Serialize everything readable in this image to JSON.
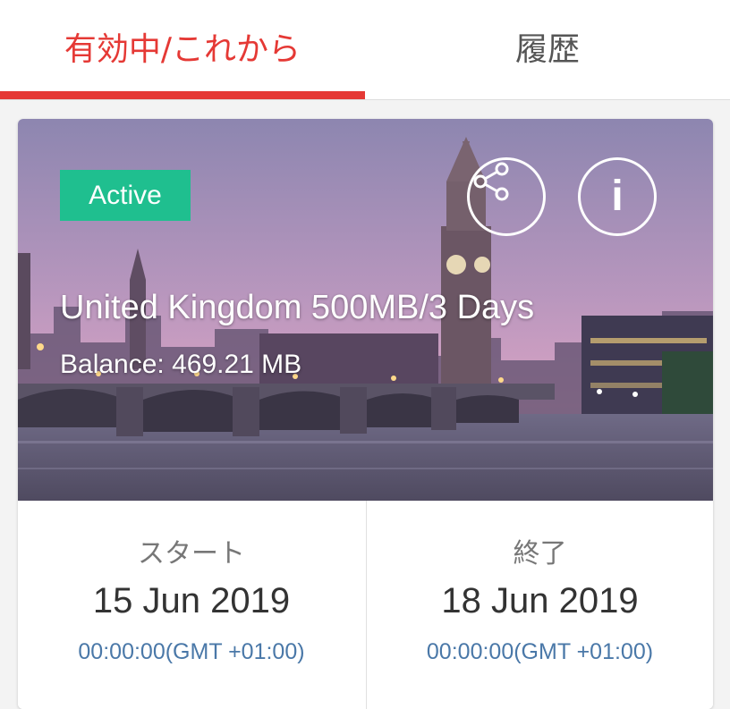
{
  "tabs": [
    {
      "label": "有効中/これから",
      "active": true
    },
    {
      "label": "履歴",
      "active": false
    }
  ],
  "colors": {
    "accent": "#e53935",
    "badge": "#1fbf8f",
    "time_text": "#4a78a8"
  },
  "card": {
    "status_badge": "Active",
    "plan_name": "United Kingdom 500MB/3 Days",
    "balance": "Balance: 469.21 MB",
    "icons": [
      "share-icon",
      "info-icon"
    ],
    "start": {
      "label": "スタート",
      "date": "15 Jun 2019",
      "time": "00:00:00(GMT +01:00)"
    },
    "end": {
      "label": "終了",
      "date": "18 Jun 2019",
      "time": "00:00:00(GMT +01:00)"
    }
  }
}
